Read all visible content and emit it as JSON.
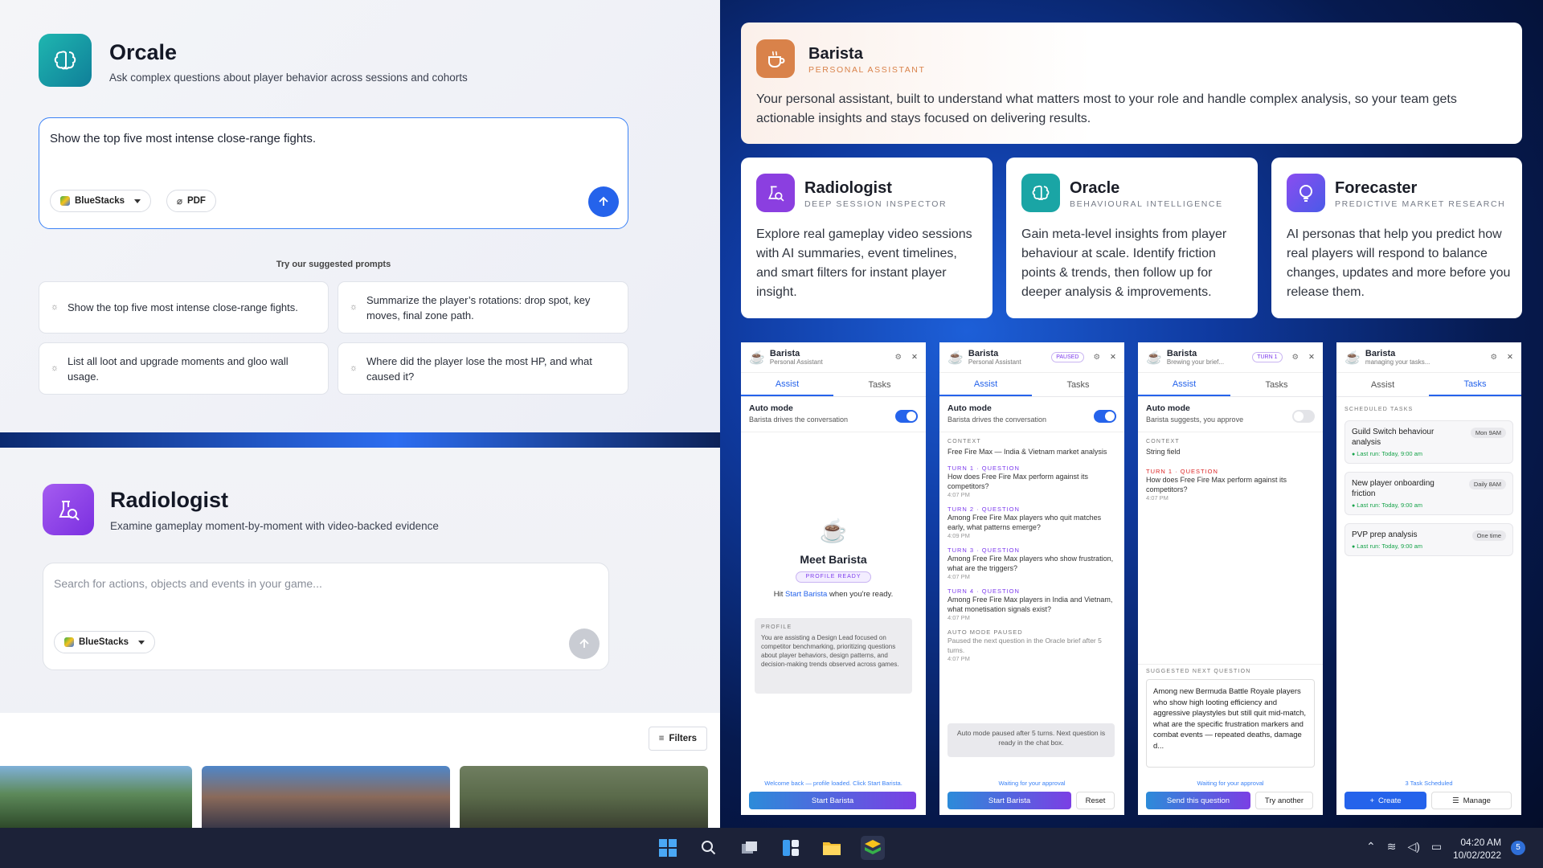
{
  "orcale": {
    "title": "Orcale",
    "subtitle": "Ask complex questions about player behavior across sessions and cohorts",
    "input_value": "Show the top five most intense close-range fights.",
    "source_chip": "BlueStacks",
    "attach_chip": "PDF",
    "suggested_heading": "Try our suggested prompts",
    "prompts": [
      "Show the top five most intense close-range fights.",
      "Summarize the player’s rotations: drop spot, key moves, final zone path.",
      "List all loot and upgrade moments and gloo wall usage.",
      "Where did the player lose the most HP, and what caused it?"
    ]
  },
  "radiologist_panel": {
    "title": "Radiologist",
    "subtitle": "Examine gameplay moment-by-moment with video-backed evidence",
    "search_placeholder": "Search for actions, objects and events in your game...",
    "source_chip": "BlueStacks",
    "filters_label": "Filters"
  },
  "barista_card": {
    "name": "Barista",
    "role": "PERSONAL ASSISTANT",
    "description": "Your personal assistant, built to understand what matters most to your role and handle complex analysis, so your team gets actionable insights and stays focused on delivering results."
  },
  "agent_cards": [
    {
      "name": "Radiologist",
      "role": "DEEP SESSION INSPECTOR",
      "description": "Explore real gameplay video sessions with AI summaries, event timelines, and smart filters for instant player insight.",
      "color": "#8b3fe0"
    },
    {
      "name": "Oracle",
      "role": "BEHAVIOURAL INTELLIGENCE",
      "description": "Gain meta-level insights from player behaviour at scale. Identify friction points & trends, then follow up for deeper analysis & improvements.",
      "color": "#1aa5a5"
    },
    {
      "name": "Forecaster",
      "role": "PREDICTIVE MARKET RESEARCH",
      "description": "AI personas that help you predict how real players will respond to balance changes, updates and more before you release them.",
      "color": "#6a42e8"
    }
  ],
  "panels": {
    "p1": {
      "name": "Barista",
      "sub": "Personal Assistant",
      "tab_assist": "Assist",
      "tab_tasks": "Tasks",
      "auto_title": "Auto mode",
      "auto_desc": "Barista drives the conversation",
      "meet": "Meet Barista",
      "badge": "PROFILE READY",
      "hit_pre": "Hit ",
      "hit_link": "Start Barista",
      "hit_post": " when you're ready.",
      "profile_label": "PROFILE",
      "profile_text": "You are assisting a Design Lead focused on competitor benchmarking, prioritizing questions about player behaviors, design patterns, and decision-making trends observed across games.",
      "footer": "Welcome back — profile loaded. Click Start Barista.",
      "button": "Start Barista"
    },
    "p2": {
      "name": "Barista",
      "sub": "Personal Assistant",
      "status": "PAUSED",
      "tab_assist": "Assist",
      "tab_tasks": "Tasks",
      "auto_title": "Auto mode",
      "auto_desc": "Barista drives the conversation",
      "context_label": "CONTEXT",
      "context": "Free Fire Max — India & Vietnam market analysis",
      "turns": [
        {
          "label": "TURN 1 · QUESTION",
          "q": "How does Free Fire Max perform against its competitors?",
          "t": "4:07 PM"
        },
        {
          "label": "TURN 2 · QUESTION",
          "q": "Among Free Fire Max players who quit matches early, what patterns emerge?",
          "t": "4:09 PM"
        },
        {
          "label": "TURN 3 · QUESTION",
          "q": "Among Free Fire Max players who show frustration, what are the triggers?",
          "t": "4:07 PM"
        },
        {
          "label": "TURN 4 · QUESTION",
          "q": "Among Free Fire Max players in India and Vietnam, what monetisation signals exist?",
          "t": "4:07 PM"
        },
        {
          "label": "AUTO MODE PAUSED",
          "q": "Paused the next question in the Oracle brief after 5 turns.",
          "t": "4:07 PM"
        }
      ],
      "notice": "Auto mode paused after 5 turns. Next question is ready in the chat box.",
      "footer": "Waiting for your approval",
      "button": "Start Barista",
      "button2": "Reset"
    },
    "p3": {
      "name": "Barista",
      "sub": "Brewing your brief...",
      "status": "TURN 1",
      "tab_assist": "Assist",
      "tab_tasks": "Tasks",
      "auto_title": "Auto mode",
      "auto_desc": "Barista suggests, you approve",
      "context_label": "CONTEXT",
      "context": "String field",
      "turn_label": "TURN 1 · QUESTION",
      "turn_q": "How does Free Fire Max perform against its competitors?",
      "turn_t": "4:07 PM",
      "suggest_label": "SUGGESTED NEXT QUESTION",
      "suggest": "Among new Bermuda Battle Royale players who show high looting efficiency and aggressive playstyles but still quit mid-match, what are the specific frustration markers and combat events — repeated deaths, damage d...",
      "footer": "Waiting for your approval",
      "button": "Send this question",
      "button2": "Try another"
    },
    "p4": {
      "name": "Barista",
      "sub": "managing your tasks...",
      "tab_assist": "Assist",
      "tab_tasks": "Tasks",
      "section": "SCHEDULED TASKS",
      "tasks": [
        {
          "name": "Guild Switch behaviour analysis",
          "badge": "Mon 9AM",
          "last": "Last run: Today, 9:00 am"
        },
        {
          "name": "New player onboarding friction",
          "badge": "Daily 8AM",
          "last": "Last run: Today, 9:00 am"
        },
        {
          "name": "PVP prep analysis",
          "badge": "One time",
          "last": "Last run: Today, 9:00 am"
        }
      ],
      "footer": "3 Task Scheduled",
      "button": "Create",
      "button2": "Manage"
    }
  },
  "taskbar": {
    "time": "04:20 AM",
    "date": "10/02/2022",
    "notifications": "5"
  },
  "colors": {
    "accent": "#2563eb",
    "barista": "#d9824a",
    "radiologist": "#8b3fe0",
    "oracle": "#1aa5a5",
    "forecaster": "#6a42e8"
  }
}
